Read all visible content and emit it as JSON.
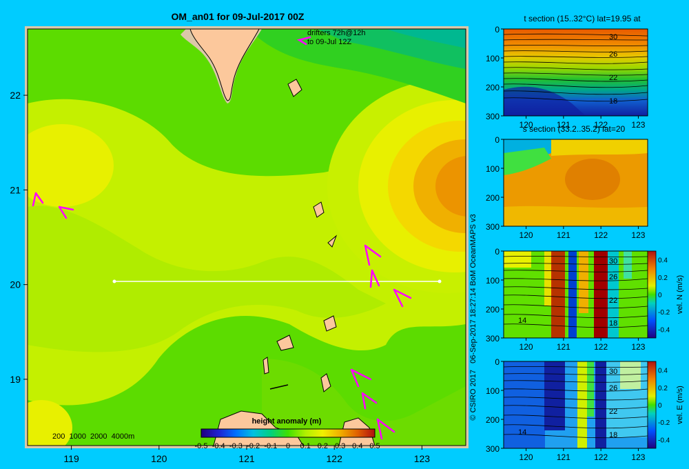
{
  "chart_data": [
    {
      "type": "heatmap",
      "title": "OM_an01 for 09-Jul-2017 00Z",
      "xticks": [
        119,
        120,
        121,
        122,
        123
      ],
      "yticks": [
        22,
        21,
        20,
        19
      ],
      "xlim": [
        118.5,
        123.5
      ],
      "ylim": [
        18.3,
        22.7
      ],
      "annotation": "drifters 72h@12h to 09-Jul 12Z",
      "annotation_lines": [
        "drifters 72h@12h",
        "to 09-Jul 12Z"
      ],
      "bathy_legend": "200  1000  2000  4000m",
      "section_line": {
        "lon": [
          119.5,
          123.2
        ],
        "lat": 20
      },
      "colorbar": {
        "label": "height anomaly (m)",
        "ticks": [
          "-0.5",
          "-0.4",
          "-0.3",
          "-0.2",
          "-0.1",
          "0",
          "0.1",
          "0.2",
          "0.3",
          "0.4",
          "0.5"
        ],
        "range": [
          -0.5,
          0.5
        ]
      }
    },
    {
      "type": "heatmap",
      "title": "t section (15..32°C) lat=19.95 at",
      "xticks": [
        "120",
        "121",
        "122",
        "123"
      ],
      "yticks": [
        "0",
        "100",
        "200",
        "300"
      ],
      "contour_labels": [
        "30",
        "26",
        "22",
        "18"
      ]
    },
    {
      "type": "heatmap",
      "title": "s section (33.2..35.2) lat=20",
      "xticks": [
        "120",
        "121",
        "122",
        "123"
      ],
      "yticks": [
        "0",
        "100",
        "200",
        "300"
      ]
    },
    {
      "type": "heatmap",
      "ylabel": "vel. N (m/s)",
      "xticks": [
        "120",
        "121",
        "122",
        "123"
      ],
      "yticks": [
        "0",
        "100",
        "200",
        "300"
      ],
      "contour_labels": [
        "30",
        "26",
        "22",
        "18",
        "14"
      ],
      "colorbar_ticks": [
        "0.4",
        "0.2",
        "0",
        "-0.2",
        "-0.4"
      ]
    },
    {
      "type": "heatmap",
      "ylabel": "vel. E (m/s)",
      "xticks": [
        "120",
        "121",
        "122",
        "123"
      ],
      "yticks": [
        "0",
        "100",
        "200",
        "300"
      ],
      "contour_labels": [
        "30",
        "26",
        "22",
        "18",
        "14"
      ],
      "colorbar_ticks": [
        "0.4",
        "0.2",
        "0",
        "-0.2",
        "-0.4"
      ]
    }
  ],
  "credit": "© CSIRO 2017   06-Sep-2017 18:27:14 BoM OceanMAPS v3"
}
